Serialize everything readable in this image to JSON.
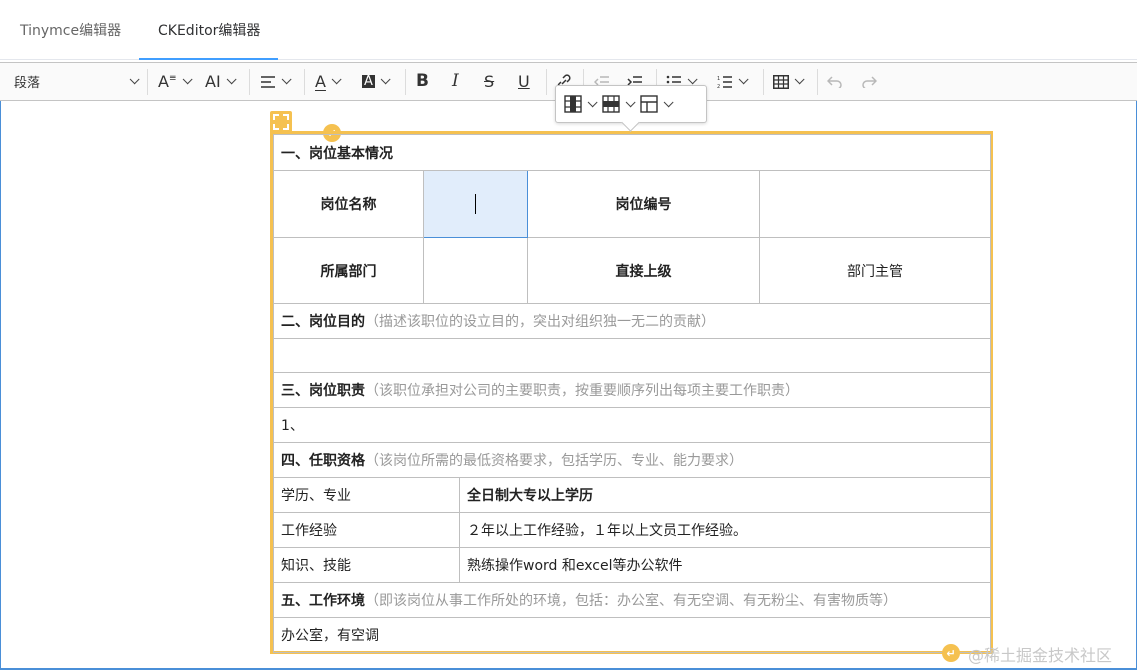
{
  "tabs": [
    "Tinymce编辑器",
    "CKEditor编辑器"
  ],
  "toolbar": {
    "heading": "段落",
    "font_size_label": "A",
    "font_family_label": "AI",
    "bold": "B",
    "italic": "I",
    "strike": "S",
    "underline": "U",
    "font_color": "A",
    "bg_color": "A"
  },
  "table": {
    "s1": "一、岗位基本情况",
    "r1": [
      "岗位名称",
      "",
      "岗位编号",
      ""
    ],
    "r2": [
      "所属部门",
      "",
      "直接上级",
      "部门主管"
    ],
    "s2_title": "二、岗位目的",
    "s2_hint": "（描述该职位的设立目的，突出对组织独一无二的贡献）",
    "s2_body": "",
    "s3_title": "三、岗位职责",
    "s3_hint": "（该职位承担对公司的主要职责，按重要顺序列出每项主要工作职责）",
    "s3_body": "1、",
    "s4_title": "四、任职资格",
    "s4_hint": "（该岗位所需的最低资格要求，包括学历、专业、能力要求）",
    "quals": [
      {
        "k": "学历、专业",
        "v": "全日制大专以上学历"
      },
      {
        "k": "工作经验",
        "v": "２年以上工作经验，１年以上文员工作经验。"
      },
      {
        "k": "知识、技能",
        "v": "熟练操作word 和excel等办公软件"
      }
    ],
    "s5_title": "五、工作环境",
    "s5_hint": "（即该岗位从事工作所处的环境，包括：办公室、有无空调、有无粉尘、有害物质等）",
    "s5_body": "办公室，有空调"
  },
  "watermark": "@稀土掘金技术社区",
  "colors": {
    "accent": "#409eff",
    "widget": "#f5c150",
    "selection": "#e1edfb"
  }
}
